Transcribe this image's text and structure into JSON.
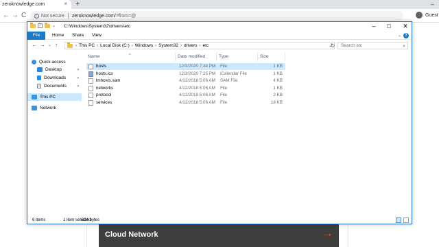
{
  "browser": {
    "tab_title": "zeroknowledge.com",
    "tab_close": "×",
    "new_tab": "+",
    "minimize": "–",
    "back": "←",
    "forward": "→",
    "reload": "C",
    "security_label": "Not secure",
    "url_host": "zeroknowledge.com",
    "url_path": "/?from=@",
    "profile_label": "Guest"
  },
  "page": {
    "banner_title": "Cloud Network",
    "banner_arrow": "→"
  },
  "explorer": {
    "title_path": "C:\\Windows\\System32\\drivers\\etc",
    "window_buttons": {
      "minimize": "–",
      "maximize": "□",
      "close": "✕"
    },
    "ribbon_tabs": [
      "File",
      "Home",
      "Share",
      "View"
    ],
    "help": "?",
    "collapse": "⌄",
    "address": {
      "back": "←",
      "forward": "→",
      "dropdown": "⌄",
      "up": "↑",
      "crumbs": [
        "This PC",
        "Local Disk (C:)",
        "Windows",
        "System32",
        "drivers",
        "etc"
      ],
      "separator": "›",
      "refresh": "↻"
    },
    "search_placeholder": "Search etc",
    "nav": {
      "quick_access": "Quick access",
      "desktop": "Desktop",
      "downloads": "Downloads",
      "documents": "Documents",
      "this_pc": "This PC",
      "network": "Network",
      "pin": "✦"
    },
    "columns": {
      "name": "Name",
      "date": "Date modified",
      "type": "Type",
      "size": "Size",
      "sort": "^"
    },
    "files": [
      {
        "name": "hosts",
        "date": "12/3/2020 7:44 PM",
        "type": "File",
        "size": "1 KB",
        "icon": "file-icon"
      },
      {
        "name": "hosts.ics",
        "date": "12/3/2020 7:25 PM",
        "type": "iCalendar File",
        "size": "1 KB",
        "icon": "calendar-file-icon"
      },
      {
        "name": "lmhosts.sam",
        "date": "4/12/2018 5:06 AM",
        "type": "SAM File",
        "size": "4 KB",
        "icon": "file-icon"
      },
      {
        "name": "networks",
        "date": "4/12/2018 5:06 AM",
        "type": "File",
        "size": "1 KB",
        "icon": "file-icon"
      },
      {
        "name": "protocol",
        "date": "4/12/2018 5:06 AM",
        "type": "File",
        "size": "2 KB",
        "icon": "file-icon"
      },
      {
        "name": "services",
        "date": "4/12/2018 5:06 AM",
        "type": "File",
        "size": "18 KB",
        "icon": "file-icon"
      }
    ],
    "status": {
      "items": "6 items",
      "selected": "1 item selected",
      "size": "824 bytes"
    }
  },
  "colors": {
    "accent": "#1979ca",
    "selection": "#cce8ff",
    "banner_bg": "#3e3e3e",
    "banner_arrow": "#e8502c"
  }
}
